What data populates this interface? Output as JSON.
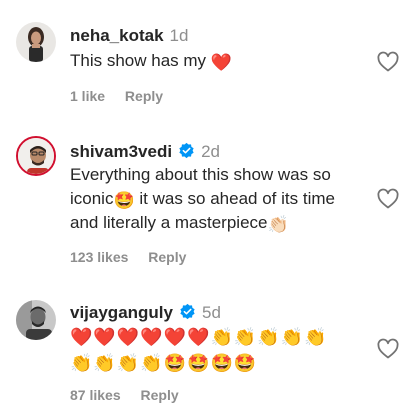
{
  "comments": [
    {
      "username": "neha_kotak",
      "time": "1d",
      "verified": false,
      "text_before": "This show has my",
      "text_emoji": "❤️",
      "likes": "1 like",
      "reply": "Reply",
      "avatar_icon": "avatar-woman-dark-top"
    },
    {
      "username": "shivam3vedi",
      "time": "2d",
      "verified": true,
      "line1": "Everything about this show was so",
      "line2_before": "iconic",
      "line2_emoji": "🤩",
      "line2_after": "it was so ahead of its time",
      "line3_before": "and literally a masterpiece",
      "line3_emoji": "👏🏻",
      "likes": "123 likes",
      "reply": "Reply",
      "avatar_icon": "avatar-man-red-border"
    },
    {
      "username": "vijayganguly",
      "time": "5d",
      "verified": true,
      "emoji_row1": "❤️❤️❤️❤️❤️❤️👏👏👏👏👏",
      "emoji_row2": "👏👏👏👏🤩🤩🤩🤩",
      "likes": "87 likes",
      "reply": "Reply",
      "avatar_icon": "avatar-man-bw"
    }
  ],
  "colors": {
    "text": "#262626",
    "muted": "#8e8e8e",
    "verified": "#0095f6",
    "story_ring": "#d10f2f"
  },
  "icons": {
    "like": "heart-outline-icon",
    "verified": "verified-badge-icon"
  }
}
